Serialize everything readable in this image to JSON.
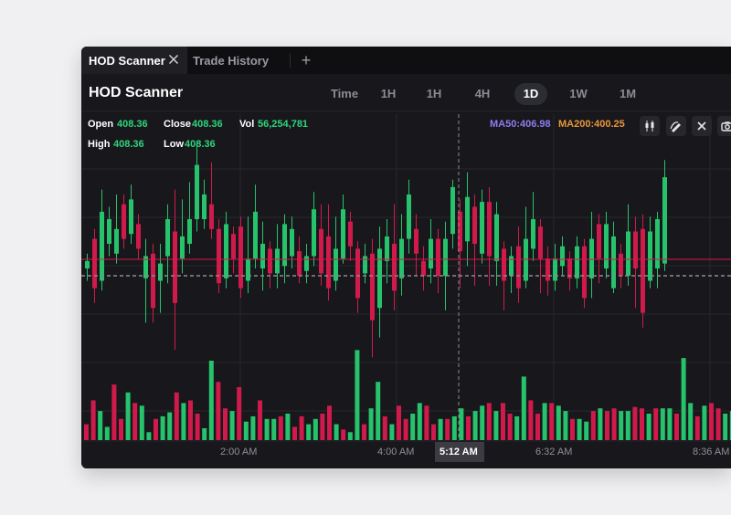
{
  "tabs": [
    {
      "label": "HOD Scanner",
      "active": true
    },
    {
      "label": "Trade History",
      "active": false
    }
  ],
  "new_tab_label": "+",
  "title": "HOD Scanner",
  "timeframes": [
    {
      "label": "Time",
      "active": false
    },
    {
      "label": "1H",
      "active": false
    },
    {
      "label": "1H",
      "active": false
    },
    {
      "label": "4H",
      "active": false
    },
    {
      "label": "1D",
      "active": true
    },
    {
      "label": "1W",
      "active": false
    },
    {
      "label": "1M",
      "active": false
    }
  ],
  "stats": {
    "open_label": "Open",
    "open": "408.36",
    "close_label": "Close",
    "close": "408.36",
    "vol_label": "Vol",
    "vol": "56,254,781",
    "high_label": "High",
    "high": "408.36",
    "low_label": "Low",
    "low": "408.36"
  },
  "ma": {
    "ma50": "MA50:406.98",
    "ma200": "MA200:400.25"
  },
  "icons": [
    "candles-icon",
    "draw-icon",
    "close-icon",
    "camera-icon"
  ],
  "colors": {
    "up": "#27c26c",
    "down": "#d01a4b",
    "ma50": "#8d7cf0",
    "ma200": "#e8953a",
    "value": "#2ed47a"
  },
  "time_axis": {
    "labels": [
      "2:00 AM",
      "4:00 AM",
      "6:32 AM",
      "8:36 AM"
    ],
    "crosshair_label": "5:12 AM"
  },
  "chart_data": {
    "type": "candlestick",
    "candles": [
      {
        "o": 0,
        "c": 0.3,
        "h": 0.6,
        "l": -0.5
      },
      {
        "o": 1.2,
        "c": -0.8,
        "h": 1.6,
        "l": -1.4
      },
      {
        "o": -0.5,
        "c": 2.3,
        "h": 3.2,
        "l": -0.9
      },
      {
        "o": 1.0,
        "c": 2.0,
        "h": 2.5,
        "l": 0.5
      },
      {
        "o": 0.6,
        "c": 1.6,
        "h": 3.0,
        "l": 0.2
      },
      {
        "o": 2.6,
        "c": 1.2,
        "h": 3.0,
        "l": 0.8
      },
      {
        "o": 1.4,
        "c": 2.8,
        "h": 3.4,
        "l": 1.0
      },
      {
        "o": 1.8,
        "c": 0.8,
        "h": 2.2,
        "l": 0.4
      },
      {
        "o": -0.4,
        "c": 0.5,
        "h": 1.2,
        "l": -2.2
      },
      {
        "o": 0.6,
        "c": -1.6,
        "h": 1.0,
        "l": -2.2
      },
      {
        "o": -0.5,
        "c": 0.2,
        "h": 1.0,
        "l": -1.8
      },
      {
        "o": 0.5,
        "c": 2.0,
        "h": 2.6,
        "l": -0.6
      },
      {
        "o": 1.5,
        "c": -1.4,
        "h": 3.2,
        "l": -3.3
      },
      {
        "o": 0.4,
        "c": 1.3,
        "h": 2.8,
        "l": -0.2
      },
      {
        "o": 1.0,
        "c": 2.0,
        "h": 3.5,
        "l": 0.6
      },
      {
        "o": 2.0,
        "c": 4.2,
        "h": 5.1,
        "l": 1.5
      },
      {
        "o": 2.0,
        "c": 3.0,
        "h": 3.6,
        "l": 1.6
      },
      {
        "o": 2.6,
        "c": 1.6,
        "h": 4.3,
        "l": 1.2
      },
      {
        "o": 1.6,
        "c": -0.6,
        "h": 2.0,
        "l": -1.0
      },
      {
        "o": -0.4,
        "c": 1.8,
        "h": 2.3,
        "l": -0.8
      },
      {
        "o": 1.4,
        "c": 0.4,
        "h": 1.7,
        "l": -0.2
      },
      {
        "o": 1.7,
        "c": -0.8,
        "h": 2.1,
        "l": -1.2
      },
      {
        "o": -0.5,
        "c": 0.4,
        "h": 2.1,
        "l": -1.0
      },
      {
        "o": 0.4,
        "c": 2.3,
        "h": 3.4,
        "l": 0.0
      },
      {
        "o": 0.0,
        "c": 1.0,
        "h": 1.9,
        "l": -0.9
      },
      {
        "o": 0.8,
        "c": -0.2,
        "h": 1.1,
        "l": -0.8
      },
      {
        "o": -0.2,
        "c": 0.8,
        "h": 1.8,
        "l": -0.8
      },
      {
        "o": 0.1,
        "c": 1.8,
        "h": 2.2,
        "l": -0.6
      },
      {
        "o": 0.5,
        "c": 1.6,
        "h": 2.1,
        "l": 0.0
      },
      {
        "o": 0.7,
        "c": -0.3,
        "h": 1.3,
        "l": -0.6
      },
      {
        "o": -0.1,
        "c": 0.5,
        "h": 1.0,
        "l": -0.6
      },
      {
        "o": 0.5,
        "c": 2.4,
        "h": 3.1,
        "l": 0.1
      },
      {
        "o": 1.6,
        "c": -0.2,
        "h": 2.6,
        "l": -0.7
      },
      {
        "o": 1.3,
        "c": -0.8,
        "h": 2.6,
        "l": -1.3
      },
      {
        "o": -0.5,
        "c": 0.8,
        "h": 2.1,
        "l": -0.9
      },
      {
        "o": 0.4,
        "c": 2.4,
        "h": 3.0,
        "l": 0.2
      },
      {
        "o": 1.9,
        "c": 0.9,
        "h": 2.3,
        "l": 0.3
      },
      {
        "o": 0.8,
        "c": -1.2,
        "h": 1.1,
        "l": -1.8
      },
      {
        "o": -0.2,
        "c": 0.5,
        "h": 1.0,
        "l": -0.6
      },
      {
        "o": 0.6,
        "c": -2.1,
        "h": 1.2,
        "l": -3.6
      },
      {
        "o": -1.6,
        "c": 0.8,
        "h": 1.7,
        "l": -2.8
      },
      {
        "o": 0.3,
        "c": 1.3,
        "h": 2.0,
        "l": -0.6
      },
      {
        "o": 1.0,
        "c": -0.9,
        "h": 2.6,
        "l": -1.7
      },
      {
        "o": -0.4,
        "c": 1.2,
        "h": 2.2,
        "l": -1.1
      },
      {
        "o": 1.2,
        "c": 3.0,
        "h": 3.6,
        "l": 0.6
      },
      {
        "o": 1.6,
        "c": 0.6,
        "h": 2.2,
        "l": -0.3
      },
      {
        "o": 0.3,
        "c": -0.3,
        "h": 0.9,
        "l": -0.9
      },
      {
        "o": 0.0,
        "c": 1.2,
        "h": 2.0,
        "l": -0.6
      },
      {
        "o": 1.2,
        "c": -0.3,
        "h": 1.6,
        "l": -1.0
      },
      {
        "o": -0.3,
        "c": 1.2,
        "h": 1.9,
        "l": -1.7
      },
      {
        "o": 1.4,
        "c": 3.3,
        "h": 3.6,
        "l": 0.8
      },
      {
        "o": 2.3,
        "c": 0.7,
        "h": 2.8,
        "l": -0.8
      },
      {
        "o": 1.1,
        "c": 2.9,
        "h": 3.9,
        "l": 0.1
      },
      {
        "o": 2.5,
        "c": 1.0,
        "h": 3.0,
        "l": -0.7
      },
      {
        "o": 0.6,
        "c": 2.7,
        "h": 3.2,
        "l": 0.2
      },
      {
        "o": 2.7,
        "c": 0.5,
        "h": 3.3,
        "l": -0.7
      },
      {
        "o": 0.3,
        "c": 2.2,
        "h": 2.7,
        "l": -0.7
      },
      {
        "o": 0.8,
        "c": -0.5,
        "h": 1.1,
        "l": -1.7
      },
      {
        "o": -0.3,
        "c": 0.5,
        "h": 0.9,
        "l": -1.0
      },
      {
        "o": 0.9,
        "c": -0.8,
        "h": 1.7,
        "l": -1.4
      },
      {
        "o": -0.5,
        "c": 1.2,
        "h": 2.5,
        "l": -0.8
      },
      {
        "o": 0.8,
        "c": 2.0,
        "h": 3.1,
        "l": 0.3
      },
      {
        "o": 1.7,
        "c": 0.4,
        "h": 2.0,
        "l": -1.0
      },
      {
        "o": 0.4,
        "c": -0.5,
        "h": 0.9,
        "l": -1.1
      },
      {
        "o": -0.5,
        "c": 0.4,
        "h": 1.0,
        "l": -0.9
      },
      {
        "o": 0.1,
        "c": 0.9,
        "h": 1.3,
        "l": -0.3
      },
      {
        "o": 0.4,
        "c": -0.4,
        "h": 0.7,
        "l": -0.9
      },
      {
        "o": -0.4,
        "c": 0.9,
        "h": 1.3,
        "l": -0.8
      },
      {
        "o": 0.9,
        "c": -1.2,
        "h": 1.2,
        "l": -1.6
      },
      {
        "o": -0.4,
        "c": 1.2,
        "h": 2.3,
        "l": -1.2
      },
      {
        "o": 1.8,
        "c": 0.4,
        "h": 2.2,
        "l": -0.6
      },
      {
        "o": 0.0,
        "c": 1.8,
        "h": 2.3,
        "l": -0.4
      },
      {
        "o": -0.8,
        "c": 1.3,
        "h": 1.9,
        "l": -1.0
      },
      {
        "o": 0.6,
        "c": -0.3,
        "h": 1.0,
        "l": -0.8
      },
      {
        "o": -0.3,
        "c": 1.5,
        "h": 2.6,
        "l": -0.7
      },
      {
        "o": 1.5,
        "c": 0.0,
        "h": 2.1,
        "l": -1.6
      },
      {
        "o": 1.6,
        "c": -1.8,
        "h": 2.2,
        "l": -2.4
      },
      {
        "o": -0.5,
        "c": 1.5,
        "h": 2.1,
        "l": -0.8
      },
      {
        "o": 0.0,
        "c": 2.0,
        "h": 2.3,
        "l": -0.8
      },
      {
        "o": 0.2,
        "c": 3.7,
        "h": 4.4,
        "l": -0.1
      }
    ],
    "volumes": [
      12,
      30,
      22,
      10,
      42,
      16,
      36,
      28,
      26,
      6,
      16,
      18,
      21,
      36,
      28,
      30,
      20,
      9,
      60,
      44,
      24,
      22,
      40,
      14,
      18,
      30,
      16,
      16,
      18,
      20,
      10,
      18,
      12,
      16,
      20,
      26,
      12,
      8,
      6,
      68,
      12,
      24,
      44,
      18,
      12,
      26,
      16,
      20,
      28,
      26,
      12,
      16,
      16,
      18,
      24,
      18,
      22,
      26,
      28,
      22,
      28,
      20,
      18,
      48,
      30,
      20,
      28,
      28,
      26,
      22,
      16,
      16,
      14,
      22,
      24,
      22,
      24,
      22,
      22,
      25,
      24,
      20,
      24,
      24,
      24,
      20,
      62,
      28,
      18,
      26,
      28,
      24,
      20,
      22
    ]
  }
}
